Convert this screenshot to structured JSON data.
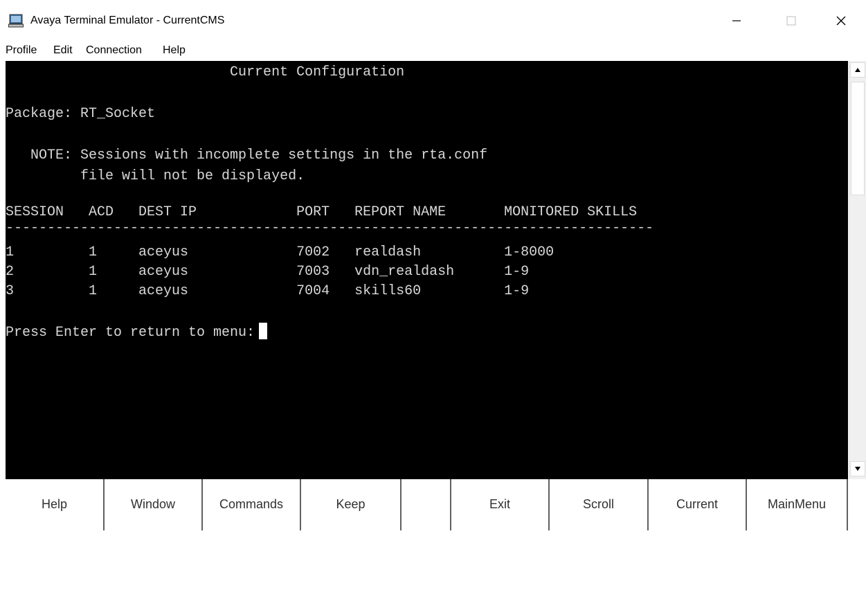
{
  "window": {
    "title": "Avaya Terminal Emulator - CurrentCMS",
    "icon": "terminal-computer-icon",
    "controls": [
      "minimize-icon",
      "maximize-icon",
      "close-icon"
    ]
  },
  "menubar": {
    "items": [
      "Profile",
      "Edit",
      "Connection",
      "Help"
    ]
  },
  "terminal": {
    "lines": [
      "                           Current Configuration",
      "",
      "Package: RT_Socket",
      "",
      "   NOTE: Sessions with incomplete settings in the rta.conf",
      "         file will not be displayed.",
      "",
      "SESSION   ACD   DEST IP            PORT   REPORT NAME       MONITORED SKILLS",
      "------------------------------------------------------------------------------",
      "1         1     aceyus             7002   realdash          1-8000",
      "2         1     aceyus             7003   vdn_realdash      1-9",
      "3         1     aceyus             7004   skills60          1-9",
      "",
      "Press Enter to return to menu:"
    ],
    "colors": {
      "background": "#000000",
      "foreground": "#d8d8d8",
      "cursor": "#ffffff"
    }
  },
  "scrollbar": {
    "up_icon": "scroll-up-arrow-icon",
    "down_icon": "scroll-down-arrow-icon"
  },
  "function_keys": [
    "Help",
    "Window",
    "Commands",
    "Keep",
    "",
    "Exit",
    "Scroll",
    "Current",
    "MainMenu"
  ]
}
